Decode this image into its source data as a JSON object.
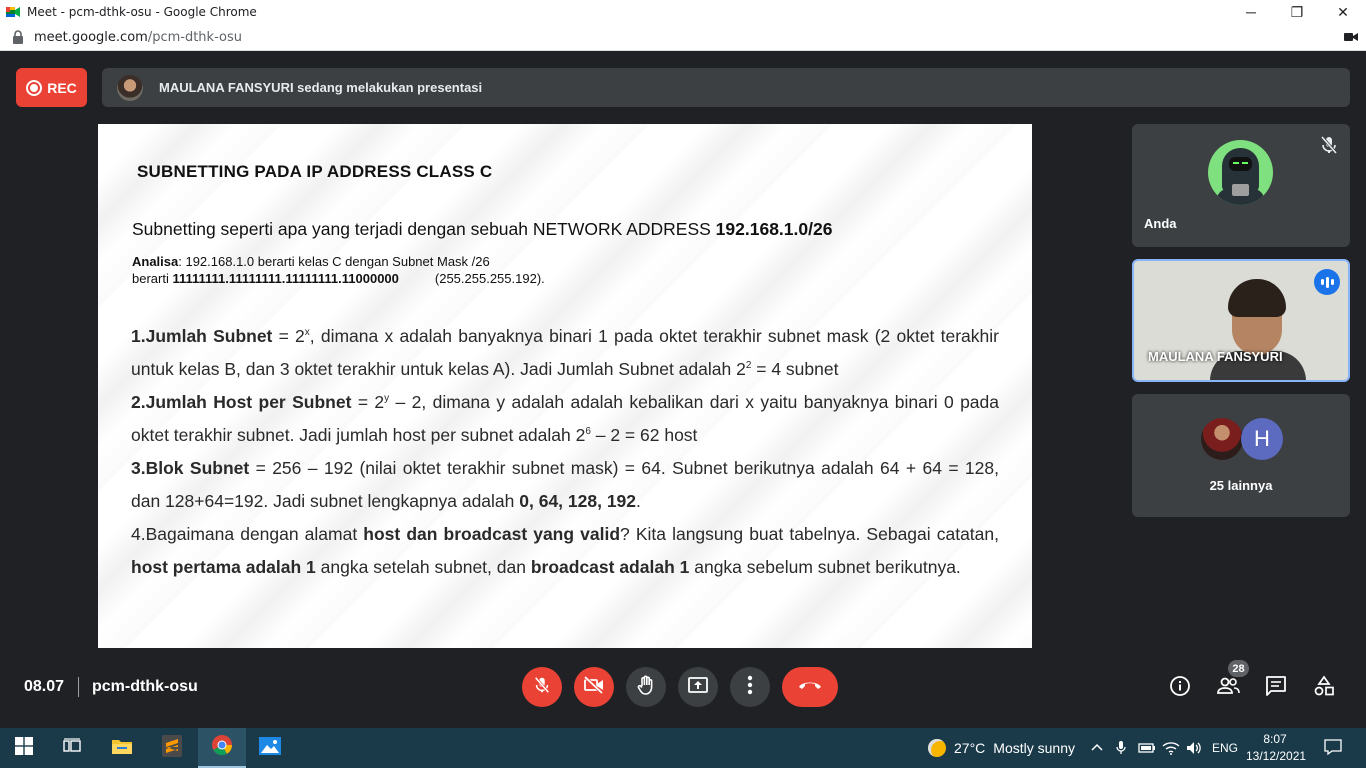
{
  "browser": {
    "window_title": "Meet - pcm-dthk-osu - Google Chrome",
    "url_host": "meet.google.com",
    "url_path": "/pcm-dthk-osu",
    "controls": {
      "minimize": "─",
      "restore": "❐",
      "close": "✕"
    }
  },
  "meet": {
    "rec_label": "REC",
    "presenting_banner": "MAULANA FANSYURI sedang melakukan presentasi",
    "slide": {
      "title": "SUBNETTING PADA IP ADDRESS CLASS C",
      "question_text": "Subnetting seperti apa yang terjadi dengan sebuah NETWORK ADDRESS ",
      "question_address": "192.168.1.0/26",
      "analysis_label": "Analisa",
      "analysis_line1": ": 192.168.1.0 berarti kelas C dengan Subnet Mask /26",
      "analysis_line2_prefix": "berarti ",
      "analysis_binary": "11111111.11111111.11111111.11000000",
      "analysis_decimal": "(255.255.255.192).",
      "p1_label": "1.Jumlah Subnet",
      "p1_a": " = 2",
      "p1_sup1": "x",
      "p1_b": ", dimana x adalah banyaknya binari 1 pada oktet terakhir subnet mask (2 oktet terakhir untuk kelas B, dan 3 oktet terakhir untuk kelas A). Jadi Jumlah Subnet adalah 2",
      "p1_sup2": "2",
      "p1_c": " = 4 subnet",
      "p2_label": "2.Jumlah Host per Subnet",
      "p2_a": " = 2",
      "p2_sup1": "y",
      "p2_b": " – 2, dimana y adalah adalah kebalikan dari x yaitu banyaknya binari 0 pada oktet terakhir subnet. Jadi jumlah host per subnet adalah 2",
      "p2_sup2": "6",
      "p2_c": " – 2 = 62 host",
      "p3_label": "3.Blok Subnet",
      "p3_a": " = 256 – 192 (nilai oktet terakhir subnet mask) = 64. Subnet berikutnya adalah 64 + 64 = 128, dan 128+64=192. Jadi subnet lengkapnya adalah ",
      "p3_bold": "0, 64, 128, 192",
      "p3_b": ".",
      "p4_a": "4.Bagaimana dengan alamat ",
      "p4_bold1": "host dan broadcast yang valid",
      "p4_b": "? Kita langsung buat tabelnya. Sebagai catatan, ",
      "p4_bold2": "host pertama adalah 1",
      "p4_c": " angka setelah subnet, dan ",
      "p4_bold3": "broadcast adalah 1",
      "p4_d": " angka sebelum subnet berikutnya."
    },
    "participants": {
      "self_name": "Anda",
      "presenter_name": "MAULANA FANSYURI",
      "others_initial": "H",
      "others_count_label": "25 lainnya"
    },
    "bottom": {
      "time": "08.07",
      "meeting_code": "pcm-dthk-osu",
      "people_count": "28"
    }
  },
  "taskbar": {
    "temperature": "27°C",
    "weather": "Mostly sunny",
    "language": "ENG",
    "clock_time": "8:07",
    "clock_date": "13/12/2021"
  },
  "colors": {
    "accent_red": "#ea4335",
    "meet_bg": "#202124",
    "tile_bg": "#3c4043",
    "speaking_blue": "#1a73e8"
  }
}
